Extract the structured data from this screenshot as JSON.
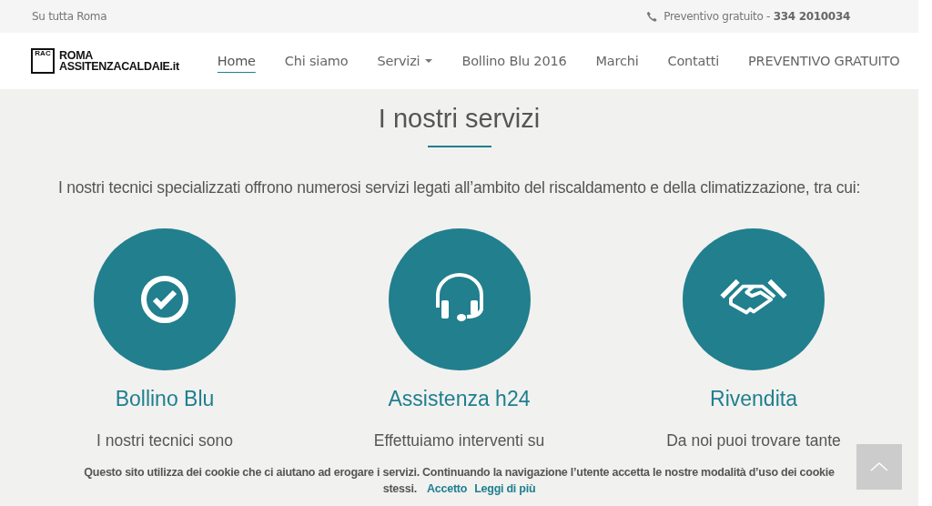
{
  "top_bar": {
    "area": "Su tutta Roma",
    "quote_label": "Preventivo gratuito - ",
    "phone": "334 2010034"
  },
  "logo": {
    "badge": "RAC",
    "line_1": "ROMA",
    "line_2": "ASSITENZACALDAIE.it"
  },
  "nav": [
    {
      "label": "Home",
      "selected": true,
      "dropdown": false
    },
    {
      "label": "Chi siamo",
      "selected": false,
      "dropdown": false
    },
    {
      "label": "Servizi",
      "selected": false,
      "dropdown": true
    },
    {
      "label": "Bollino Blu 2016",
      "selected": false,
      "dropdown": false
    },
    {
      "label": "Marchi",
      "selected": false,
      "dropdown": false
    },
    {
      "label": "Contatti",
      "selected": false,
      "dropdown": false
    },
    {
      "label": "PREVENTIVO GRATUITO",
      "selected": false,
      "dropdown": false
    }
  ],
  "section": {
    "title": "I nostri servizi",
    "intro": "I nostri tecnici specializzati offrono numerosi servizi legati all’ambito del riscaldamento e della climatizzazione, tra cui:"
  },
  "services": [
    {
      "kind": "check",
      "title": "Bollino Blu",
      "text": "I nostri tecnici sono"
    },
    {
      "kind": "headset",
      "title": "Assistenza h24",
      "text": "Effettuiamo interventi su"
    },
    {
      "kind": "handshake",
      "title": "Rivendita",
      "text": "Da noi puoi  trovare tante"
    }
  ],
  "cookie_bar": {
    "text": "Questo sito utilizza dei cookie che ci aiutano ad erogare i servizi. Continuando la navigazione l’utente accetta le nostre modalità d’uso dei cookie stessi.",
    "accept": "Accetto",
    "more": "Leggi di più"
  }
}
